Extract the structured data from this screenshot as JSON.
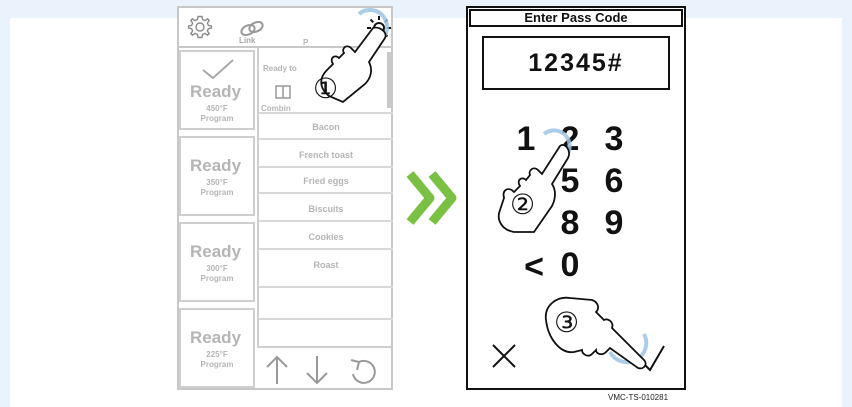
{
  "left_screen": {
    "link_label": "Link",
    "programs_label": "P",
    "ready_to_label": "Ready to",
    "combine_label": "Combin",
    "slots": [
      {
        "status": "Ready",
        "temp": "450°F",
        "label": "Program",
        "check": true
      },
      {
        "status": "Ready",
        "temp": "350°F",
        "label": "Program",
        "check": false
      },
      {
        "status": "Ready",
        "temp": "300°F",
        "label": "Program",
        "check": false
      },
      {
        "status": "Ready",
        "temp": "225°F",
        "label": "Program",
        "check": false
      }
    ],
    "menu_items": [
      "Bacon",
      "French toast",
      "Fried eggs",
      "Biscuits",
      "Cookies",
      "Roast"
    ],
    "icons": [
      "gear-icon",
      "link-icon",
      "sun-icon",
      "up-arrow-icon",
      "down-arrow-icon",
      "undo-icon"
    ]
  },
  "transition_icon": "double-chevron-right",
  "right_screen": {
    "title": "Enter Pass Code",
    "code": "12345#",
    "keys": {
      "row1": [
        "1",
        "2",
        "3"
      ],
      "row2": [
        "5",
        "6"
      ],
      "row3": [
        "8",
        "9"
      ],
      "back": "<",
      "zero": "0"
    },
    "cancel_icon": "x-icon",
    "confirm_icon": "check-icon"
  },
  "steps": [
    "①",
    "②",
    "③"
  ],
  "doc_id": "VMC-TS-010281",
  "colors": {
    "accent_green": "#7ac143",
    "touch_blue": "#9cc4e4",
    "grey_ui": "#b5b5b5",
    "ink": "#111111"
  }
}
